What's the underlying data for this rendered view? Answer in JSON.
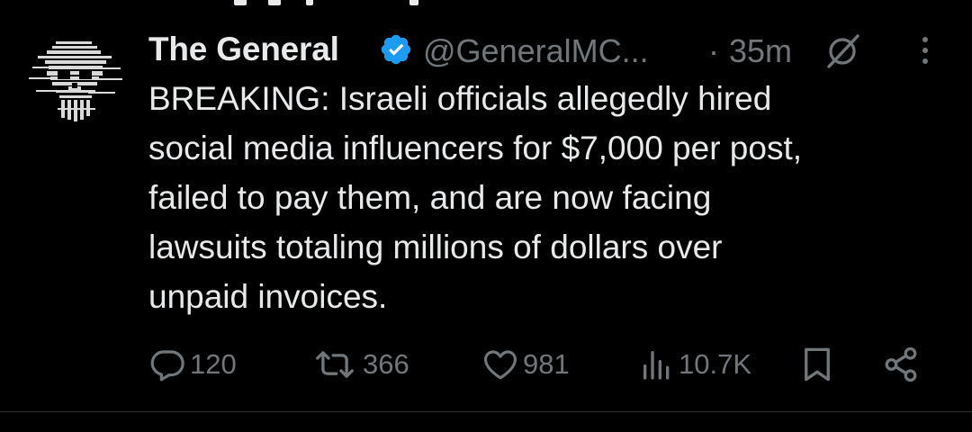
{
  "tweet": {
    "display_name": "The General",
    "handle": "@GeneralMC...",
    "separator": "·",
    "time": "35m",
    "body_lines": [
      "BREAKING: Israeli officials allegedly hired",
      "social media influencers for $7,000 per post,",
      "failed to pay them, and are now facing",
      "lawsuits totaling millions of dollars over",
      "unpaid invoices."
    ]
  },
  "actions": {
    "reply_count": "120",
    "repost_count": "366",
    "like_count": "981",
    "views_count": "10.7K"
  },
  "icons": {
    "verified": "verified-badge-icon",
    "grok": "grok-icon",
    "more": "more-options-icon",
    "reply": "reply-icon",
    "repost": "repost-icon",
    "like": "like-icon",
    "views": "views-icon",
    "bookmark": "bookmark-icon",
    "share": "share-icon"
  },
  "colors": {
    "background": "#000000",
    "text_primary": "#e7e9ea",
    "text_secondary": "#71767b",
    "verified_blue": "#1d9bf0",
    "divider": "#2f3336"
  }
}
